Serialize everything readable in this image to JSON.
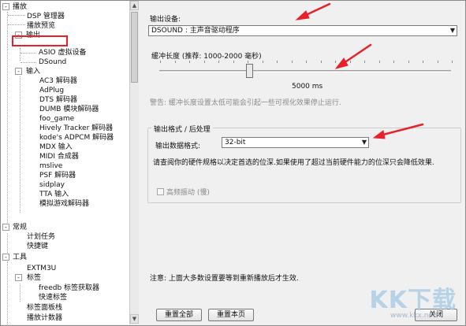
{
  "tree": {
    "items": [
      {
        "label": "播放",
        "toggle": "-"
      },
      {
        "label": "DSP 管理器"
      },
      {
        "label": "播放预览"
      },
      {
        "label": "输出",
        "toggle": "-"
      },
      {
        "label": "ASIO 虚拟设备"
      },
      {
        "label": "DSound"
      },
      {
        "label": "输入",
        "toggle": "-"
      },
      {
        "label": "AC3 解码器"
      },
      {
        "label": "AdPlug"
      },
      {
        "label": "DTS 解码器"
      },
      {
        "label": "DUMB 模块解码器"
      },
      {
        "label": "foo_game"
      },
      {
        "label": "Hively Tracker 解码器"
      },
      {
        "label": "kode's ADPCM 解码器"
      },
      {
        "label": "MDX 输入"
      },
      {
        "label": "MIDI 合成器"
      },
      {
        "label": "mslive"
      },
      {
        "label": "PSF 解码器"
      },
      {
        "label": "sidplay"
      },
      {
        "label": "TTA 输入"
      },
      {
        "label": "模拟游戏解码器"
      },
      {
        "label": "常规",
        "toggle": "-"
      },
      {
        "label": "计划任务"
      },
      {
        "label": "快捷键"
      },
      {
        "label": "工具",
        "toggle": "-"
      },
      {
        "label": "EXTM3U"
      },
      {
        "label": "标签",
        "toggle": "-"
      },
      {
        "label": "freedb 标签获取器"
      },
      {
        "label": "快速标签"
      },
      {
        "label": "标签面板栈"
      },
      {
        "label": "播放计数器"
      }
    ]
  },
  "output": {
    "device_label": "输出设备:",
    "device_value": "DSOUND : 主声音驱动程序",
    "buffer_label": "缓冲长度 (推荐: 1000-2000 毫秒)",
    "buffer_value_text": "5000 ms",
    "buffer_fraction": 0.31,
    "warning_text": "警告: 缓冲长度设置太低可能会引起一些可视化效果停止运行.",
    "format_group_title": "输出格式 / 后处理",
    "format_label": "输出数据格式:",
    "format_value": "32-bit",
    "info_text": "请查阅你的硬件规格以决定首选的位深.如果使用了超过当前硬件能力的位深只会降低效果.",
    "dither_label": "高频振动 (慢)",
    "dither_checked": false,
    "note": "注意: 上面大多数设置要等到重新播放后才生效."
  },
  "buttons": {
    "reset_all": "重置全部",
    "reset_page": "重置本页",
    "close": "关闭"
  },
  "watermark": {
    "logo": "KK下载",
    "url": "www.kkx.net"
  },
  "colors": {
    "annotation_red": "#e8202a",
    "background": "#f0f0f0"
  }
}
